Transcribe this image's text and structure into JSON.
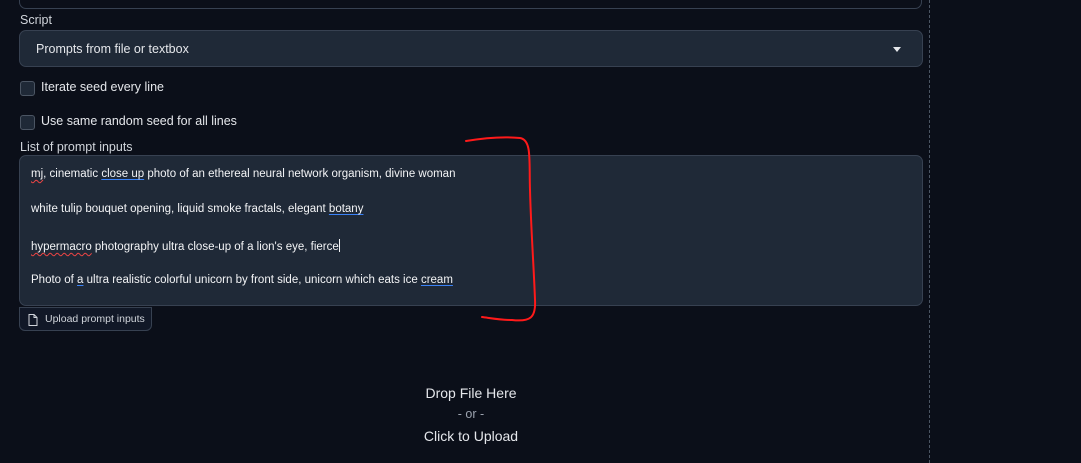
{
  "script_section": {
    "label": "Script",
    "selected": "Prompts from file or textbox"
  },
  "options": {
    "iterate_seed": "Iterate seed every line",
    "same_seed": "Use same random seed for all lines"
  },
  "prompt_inputs": {
    "label": "List of prompt inputs",
    "lines": [
      {
        "parts": [
          "mj",
          ", cinematic ",
          "close up",
          " photo of an ethereal neural network organism, divine woman"
        ]
      },
      {
        "parts": [
          "white tulip bouquet opening, liquid smoke fractals, elegant ",
          "botany"
        ]
      },
      {
        "parts": [
          "hypermacro",
          " photography ultra close-up of a lion's eye, fierce"
        ]
      },
      {
        "parts": [
          "Photo of ",
          "a",
          " ultra realistic colorful unicorn by front side, unicorn which eats ice ",
          "cream"
        ]
      }
    ],
    "upload_button": "Upload prompt inputs"
  },
  "file_drop": {
    "title": "Drop File Here",
    "separator": "- or -",
    "action": "Click to Upload"
  },
  "icons": {
    "dropdown": "chevron-down-icon",
    "upload": "file-icon"
  },
  "colors": {
    "background": "#0b0f19",
    "field_background": "#1f2937",
    "border": "#374151",
    "annotation": "#ff1a1a",
    "spellcheck": "#ef4444",
    "grammar": "#3b82f6"
  }
}
